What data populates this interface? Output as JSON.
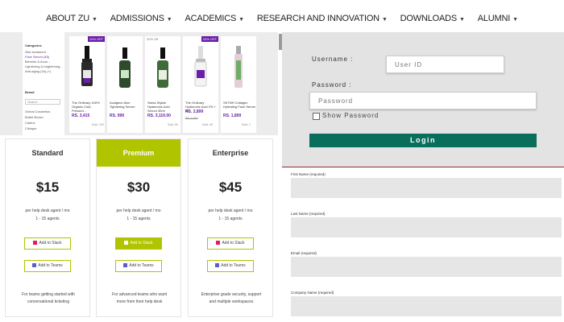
{
  "nav": {
    "items": [
      {
        "label": "ABOUT ZU"
      },
      {
        "label": "ADMISSIONS"
      },
      {
        "label": "ACADEMICS"
      },
      {
        "label": "RESEARCH AND INNOVATION"
      },
      {
        "label": "DOWNLOADS"
      },
      {
        "label": "ALUMNI"
      }
    ]
  },
  "store": {
    "filters": {
      "categories_title": "Categories",
      "items": [
        "Skin treatment",
        "Face Serum (48)",
        "Blemish & Acne...",
        "Lightening & brightening...",
        "Anti-aging (16) (+)"
      ],
      "brand_title": "Brand",
      "search_placeholder": "Search",
      "brands": [
        "Global Cosmetics",
        "Bobbi Brown",
        "Clarins",
        "Clinique"
      ]
    },
    "products": [
      {
        "badge": "10% OFF",
        "badge_off": "",
        "name": "The Ordinary 100% Organic Cold-Pressed...",
        "price": "RS. 3,415",
        "old_price": "",
        "sub": "Sold: 120"
      },
      {
        "badge": "",
        "badge_off": "",
        "name": "Avalgene Aloe Tightening Serum",
        "price": "RS. 999",
        "old_price": "",
        "sub": ""
      },
      {
        "badge": "",
        "badge_off": "20% Off",
        "name": "Swiss Stylish Hyaluronic Acid Serum 30ml",
        "price": "RS. 3,119.00",
        "old_price": "",
        "sub": "Sold: 50"
      },
      {
        "badge": "20% OFF",
        "badge_off": "",
        "name": "The Ordinary Hyaluronic Acid 2% + B5",
        "price": "RS. 2,899",
        "old_price": "RS. 3,300",
        "sub": "Sold: 40"
      },
      {
        "badge": "",
        "badge_off": "",
        "name": "SKTNH Collagen Hydrating Face Serum",
        "price": "RS. 1,899",
        "old_price": "",
        "sub": "Sold: 1"
      }
    ]
  },
  "login": {
    "username_label": "Username :",
    "username_placeholder": "User ID",
    "password_label": "Password :",
    "password_placeholder": "Password",
    "show_password_label": "Show Password",
    "login_label": "Login"
  },
  "pricing": {
    "plans": [
      {
        "name": "Standard",
        "price": "$15",
        "per": "per help desk agent / mo",
        "agents": "1 - 15 agents",
        "slack": "Add to Slack",
        "teams": "Add to Teams",
        "desc": "For teams getting started with conversational ticketing"
      },
      {
        "name": "Premium",
        "price": "$30",
        "per": "per help desk agent / mo",
        "agents": "1 - 15 agents",
        "slack": "Add to Slack",
        "teams": "Add to Teams",
        "desc": "For advanced teams who want more from their help desk"
      },
      {
        "name": "Enterprise",
        "price": "$45",
        "per": "per help desk agent / mo",
        "agents": "1 - 15 agents",
        "slack": "Add to Slack",
        "teams": "Add to Teams",
        "desc": "Enterprise grade security, support and multiple workspaces"
      }
    ]
  },
  "form": {
    "first_name_label": "First Name (required)",
    "last_name_label": "Last Name (required)",
    "email_label": "Email (required)",
    "company_label": "Company Name (required)"
  },
  "colors": {
    "accent_green": "#b0c400",
    "login_button": "#0a6e5c",
    "product_purple": "#6a1fa8"
  }
}
